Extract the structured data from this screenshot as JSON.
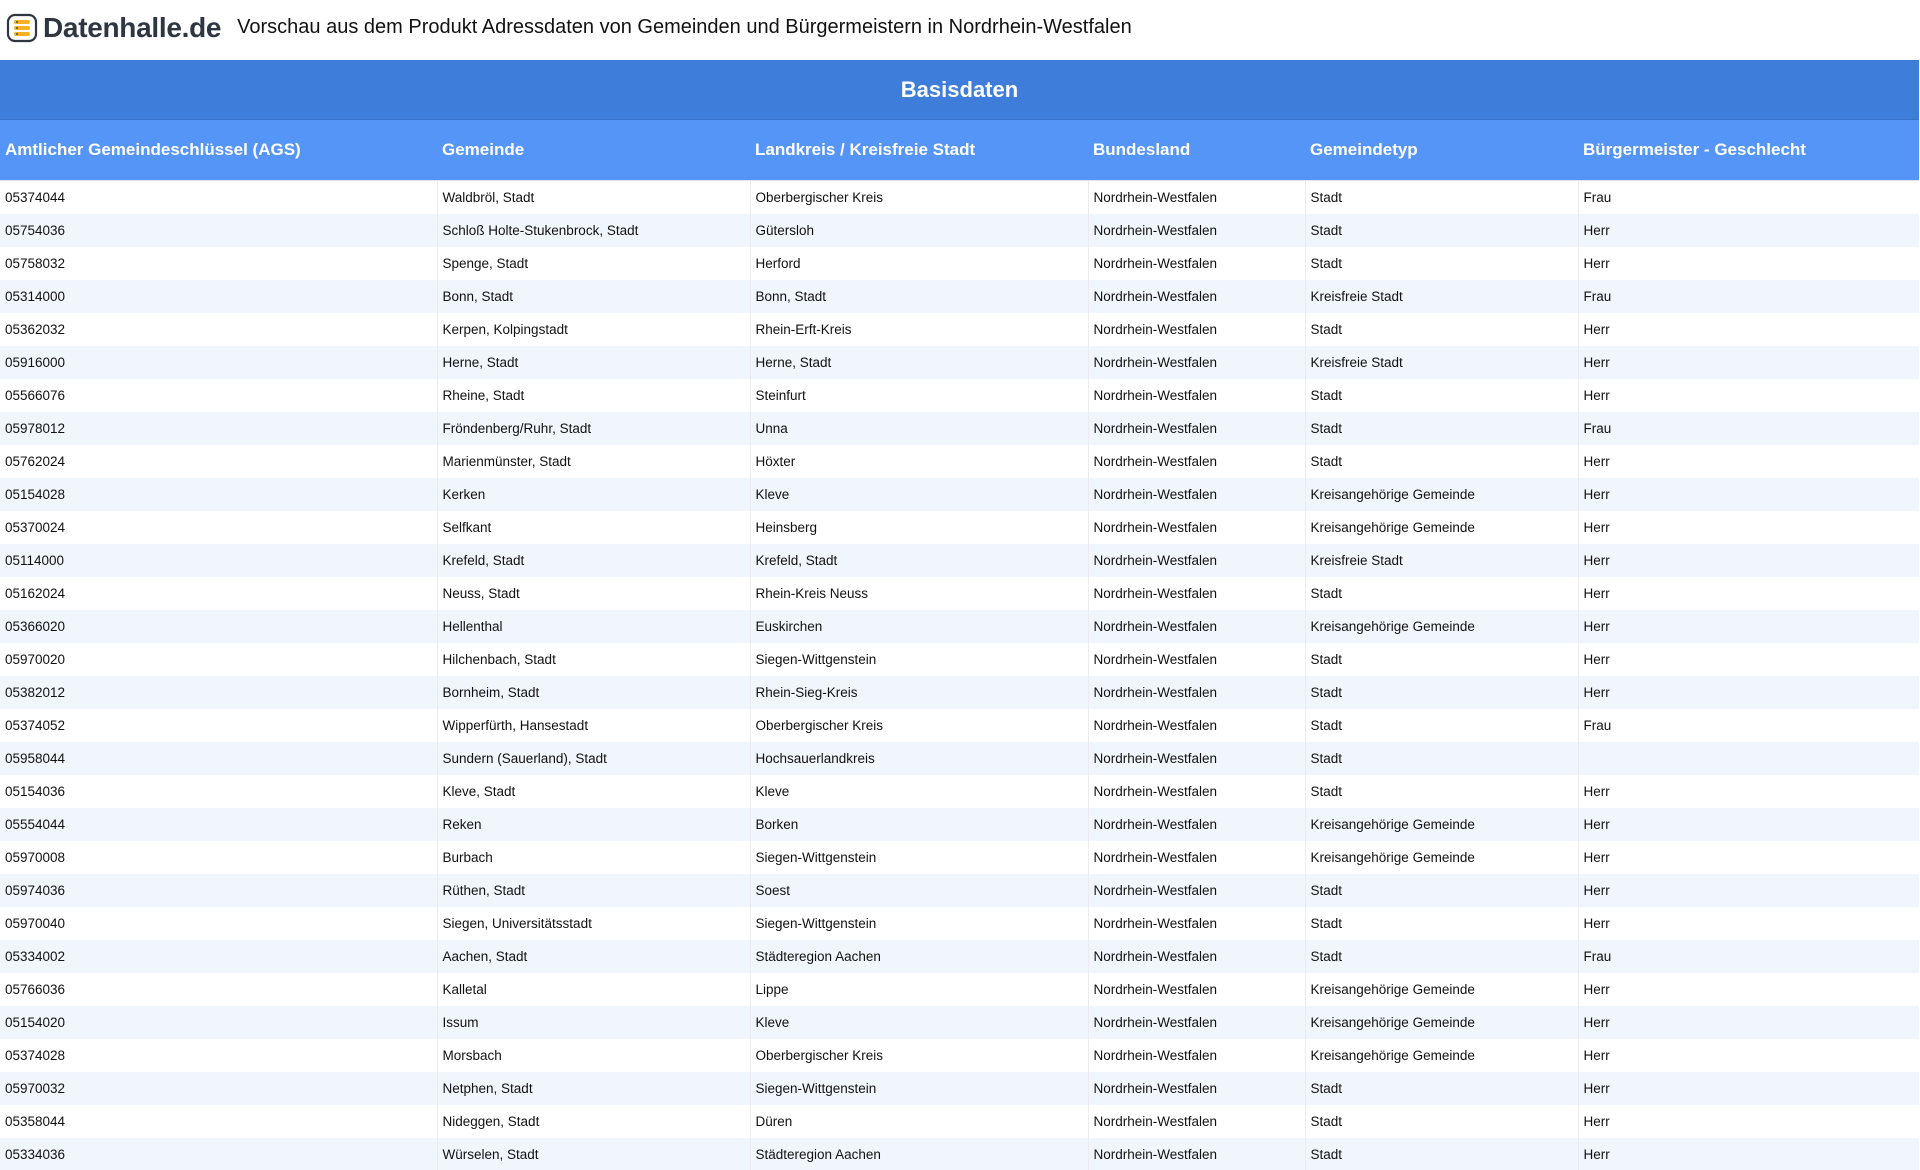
{
  "header": {
    "logo_text": "Datenhalle.de",
    "title": "Vorschau aus dem Produkt Adressdaten von Gemeinden und Bürgermeistern in Nordrhein-Westfalen"
  },
  "section": {
    "title": "Basisdaten"
  },
  "table": {
    "columns": [
      "Amtlicher Gemeindeschlüssel (AGS)",
      "Gemeinde",
      "Landkreis / Kreisfreie Stadt",
      "Bundesland",
      "Gemeindetyp",
      "Bürgermeister - Geschlecht"
    ],
    "rows": [
      [
        "05374044",
        "Waldbröl, Stadt",
        "Oberbergischer Kreis",
        "Nordrhein-Westfalen",
        "Stadt",
        "Frau"
      ],
      [
        "05754036",
        "Schloß Holte-Stukenbrock, Stadt",
        "Gütersloh",
        "Nordrhein-Westfalen",
        "Stadt",
        "Herr"
      ],
      [
        "05758032",
        "Spenge, Stadt",
        "Herford",
        "Nordrhein-Westfalen",
        "Stadt",
        "Herr"
      ],
      [
        "05314000",
        "Bonn, Stadt",
        "Bonn, Stadt",
        "Nordrhein-Westfalen",
        "Kreisfreie Stadt",
        "Frau"
      ],
      [
        "05362032",
        "Kerpen, Kolpingstadt",
        "Rhein-Erft-Kreis",
        "Nordrhein-Westfalen",
        "Stadt",
        "Herr"
      ],
      [
        "05916000",
        "Herne, Stadt",
        "Herne, Stadt",
        "Nordrhein-Westfalen",
        "Kreisfreie Stadt",
        "Herr"
      ],
      [
        "05566076",
        "Rheine, Stadt",
        "Steinfurt",
        "Nordrhein-Westfalen",
        "Stadt",
        "Herr"
      ],
      [
        "05978012",
        "Fröndenberg/Ruhr, Stadt",
        "Unna",
        "Nordrhein-Westfalen",
        "Stadt",
        "Frau"
      ],
      [
        "05762024",
        "Marienmünster, Stadt",
        "Höxter",
        "Nordrhein-Westfalen",
        "Stadt",
        "Herr"
      ],
      [
        "05154028",
        "Kerken",
        "Kleve",
        "Nordrhein-Westfalen",
        "Kreisangehörige Gemeinde",
        "Herr"
      ],
      [
        "05370024",
        "Selfkant",
        "Heinsberg",
        "Nordrhein-Westfalen",
        "Kreisangehörige Gemeinde",
        "Herr"
      ],
      [
        "05114000",
        "Krefeld, Stadt",
        "Krefeld, Stadt",
        "Nordrhein-Westfalen",
        "Kreisfreie Stadt",
        "Herr"
      ],
      [
        "05162024",
        "Neuss, Stadt",
        "Rhein-Kreis Neuss",
        "Nordrhein-Westfalen",
        "Stadt",
        "Herr"
      ],
      [
        "05366020",
        "Hellenthal",
        "Euskirchen",
        "Nordrhein-Westfalen",
        "Kreisangehörige Gemeinde",
        "Herr"
      ],
      [
        "05970020",
        "Hilchenbach, Stadt",
        "Siegen-Wittgenstein",
        "Nordrhein-Westfalen",
        "Stadt",
        "Herr"
      ],
      [
        "05382012",
        "Bornheim, Stadt",
        "Rhein-Sieg-Kreis",
        "Nordrhein-Westfalen",
        "Stadt",
        "Herr"
      ],
      [
        "05374052",
        "Wipperfürth, Hansestadt",
        "Oberbergischer Kreis",
        "Nordrhein-Westfalen",
        "Stadt",
        "Frau"
      ],
      [
        "05958044",
        "Sundern (Sauerland), Stadt",
        "Hochsauerlandkreis",
        "Nordrhein-Westfalen",
        "Stadt",
        ""
      ],
      [
        "05154036",
        "Kleve, Stadt",
        "Kleve",
        "Nordrhein-Westfalen",
        "Stadt",
        "Herr"
      ],
      [
        "05554044",
        "Reken",
        "Borken",
        "Nordrhein-Westfalen",
        "Kreisangehörige Gemeinde",
        "Herr"
      ],
      [
        "05970008",
        "Burbach",
        "Siegen-Wittgenstein",
        "Nordrhein-Westfalen",
        "Kreisangehörige Gemeinde",
        "Herr"
      ],
      [
        "05974036",
        "Rüthen, Stadt",
        "Soest",
        "Nordrhein-Westfalen",
        "Stadt",
        "Herr"
      ],
      [
        "05970040",
        "Siegen, Universitätsstadt",
        "Siegen-Wittgenstein",
        "Nordrhein-Westfalen",
        "Stadt",
        "Herr"
      ],
      [
        "05334002",
        "Aachen, Stadt",
        "Städteregion Aachen",
        "Nordrhein-Westfalen",
        "Stadt",
        "Frau"
      ],
      [
        "05766036",
        "Kalletal",
        "Lippe",
        "Nordrhein-Westfalen",
        "Kreisangehörige Gemeinde",
        "Herr"
      ],
      [
        "05154020",
        "Issum",
        "Kleve",
        "Nordrhein-Westfalen",
        "Kreisangehörige Gemeinde",
        "Herr"
      ],
      [
        "05374028",
        "Morsbach",
        "Oberbergischer Kreis",
        "Nordrhein-Westfalen",
        "Kreisangehörige Gemeinde",
        "Herr"
      ],
      [
        "05970032",
        "Netphen, Stadt",
        "Siegen-Wittgenstein",
        "Nordrhein-Westfalen",
        "Stadt",
        "Herr"
      ],
      [
        "05358044",
        "Nideggen, Stadt",
        "Düren",
        "Nordrhein-Westfalen",
        "Stadt",
        "Herr"
      ],
      [
        "05334036",
        "Würselen, Stadt",
        "Städteregion Aachen",
        "Nordrhein-Westfalen",
        "Stadt",
        "Herr"
      ]
    ]
  }
}
